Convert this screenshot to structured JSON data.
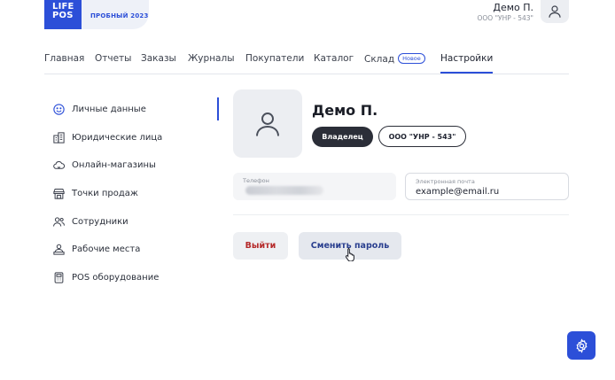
{
  "header": {
    "logo_line1": "LIFE",
    "logo_line2": "POS",
    "trial_badge": "ПРОБНЫЙ 2023",
    "user_name": "Демо П.",
    "user_org": "ООО \"УНР - 543\""
  },
  "tabs": [
    {
      "label": "Главная"
    },
    {
      "label": "Отчеты"
    },
    {
      "label": "Заказы"
    },
    {
      "label": "Журналы"
    },
    {
      "label": "Покупатели"
    },
    {
      "label": "Каталог"
    },
    {
      "label": "Склад",
      "badge": "Новое"
    },
    {
      "label": "Настройки",
      "active": true
    }
  ],
  "sidebar": {
    "items": [
      {
        "label": "Личные данные",
        "icon": "smile-icon",
        "active": true
      },
      {
        "label": "Юридические лица",
        "icon": "building-icon"
      },
      {
        "label": "Онлайн-магазины",
        "icon": "cloud-icon"
      },
      {
        "label": "Точки продаж",
        "icon": "store-icon"
      },
      {
        "label": "Сотрудники",
        "icon": "users-icon"
      },
      {
        "label": "Рабочие места",
        "icon": "workstation-icon"
      },
      {
        "label": "POS оборудование",
        "icon": "pos-terminal-icon"
      }
    ]
  },
  "profile": {
    "name": "Демо П.",
    "role": "Владелец",
    "organization": "ООО \"УНР - 543\"",
    "phone_label": "Телефон",
    "phone_value_hidden": true,
    "email_label": "Электронная почта",
    "email_value": "example@email.ru"
  },
  "actions": {
    "logout_label": "Выйти",
    "change_password_label": "Сменить пароль"
  },
  "colors": {
    "accent": "#2c4fd8",
    "dark_chip": "#2b2e38",
    "danger": "#b52a2a"
  }
}
